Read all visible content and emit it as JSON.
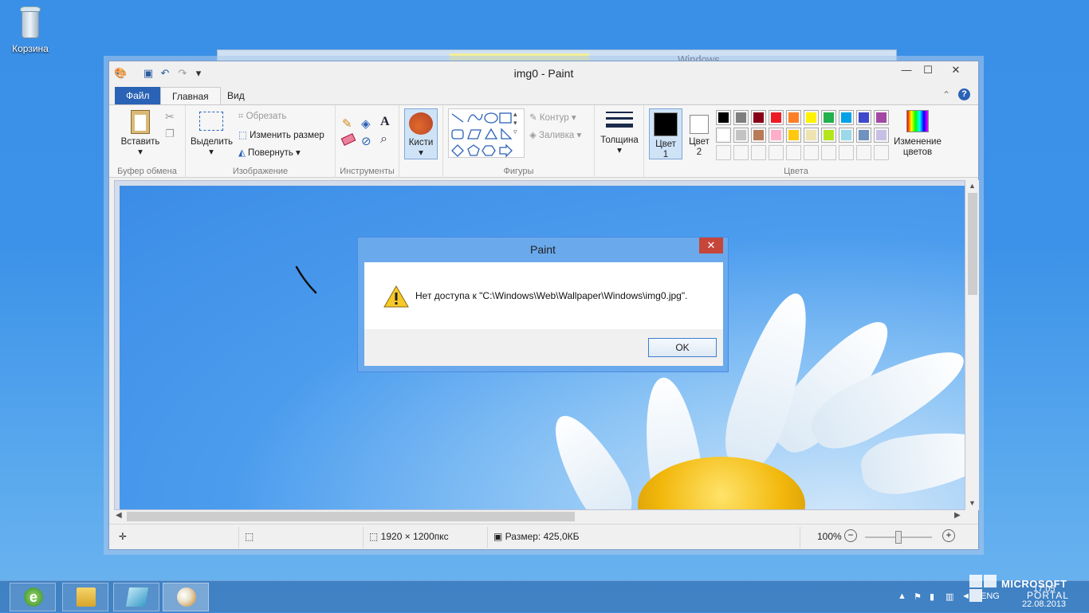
{
  "desktop": {
    "recycle_label": "Корзина"
  },
  "back_window": {
    "title": "Windows"
  },
  "window": {
    "title": "img0 - Paint",
    "qa_undo": "↶",
    "qa_redo": "↷",
    "qa_more": "▾",
    "minimize": "—",
    "maximize": "☐",
    "close": "✕"
  },
  "tabs": {
    "file": "Файл",
    "home": "Главная",
    "view": "Вид",
    "help": "?"
  },
  "ribbon": {
    "clipboard": {
      "label": "Буфер обмена",
      "paste": "Вставить",
      "paste_arrow": "▾"
    },
    "image": {
      "label": "Изображение",
      "select": "Выделить",
      "select_arrow": "▾",
      "crop": "Обрезать",
      "resize": "Изменить размер",
      "rotate": "Повернуть ▾"
    },
    "tools": {
      "label": "Инструменты"
    },
    "brushes": {
      "label": "Кисти",
      "arrow": "▾"
    },
    "shapes": {
      "label": "Фигуры",
      "outline": "Контур ▾",
      "fill": "Заливка ▾"
    },
    "thickness": {
      "label": "Толщина",
      "arrow": "▾"
    },
    "colors": {
      "label": "Цвета",
      "color1": "Цвет\n1",
      "color1_a": "Цвет",
      "color1_b": "1",
      "color2_a": "Цвет",
      "color2_b": "2",
      "edit_a": "Изменение",
      "edit_b": "цветов",
      "palette": [
        "#000000",
        "#7f7f7f",
        "#880015",
        "#ed1c24",
        "#ff7f27",
        "#fff200",
        "#22b14c",
        "#00a2e8",
        "#3f48cc",
        "#a349a4",
        "#ffffff",
        "#c3c3c3",
        "#b97a57",
        "#ffaec9",
        "#ffc90e",
        "#efe4b0",
        "#b5e61d",
        "#99d9ea",
        "#7092be",
        "#c8bfe7"
      ],
      "primary": "#000000",
      "secondary": "#ffffff"
    }
  },
  "status": {
    "dimensions": "1920 × 1200пкс",
    "size": "Размер: 425,0КБ",
    "zoom": "100%"
  },
  "dialog": {
    "title": "Paint",
    "close": "✕",
    "message": "Нет доступа к \"C:\\Windows\\Web\\Wallpaper\\Windows\\img0.jpg\".",
    "ok": "OK"
  },
  "tray": {
    "lang": "ENG",
    "time": "17:05",
    "date": "22.08.2013",
    "watermark_a": "MICROSOFT",
    "watermark_b": "PORTAL"
  }
}
